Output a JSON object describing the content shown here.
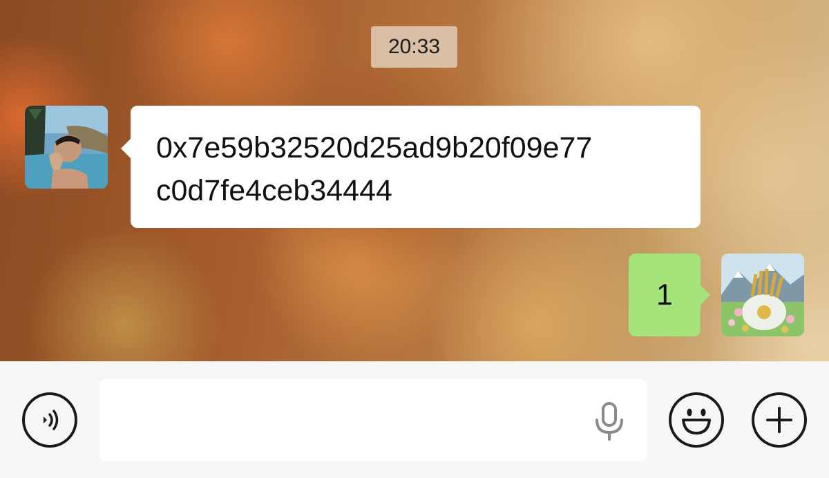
{
  "chat": {
    "time": "20:33",
    "messages": [
      {
        "direction": "incoming",
        "lines": [
          "0x7e59b32520d25ad9b20f09e77",
          "c0d7fe4ceb34444"
        ]
      },
      {
        "direction": "outgoing",
        "text": "1"
      }
    ]
  },
  "input_bar": {
    "input_value": "",
    "icons": {
      "voice": "voice-mode-icon",
      "mic": "microphone-icon",
      "emoji": "emoji-icon",
      "plus": "plus-icon"
    }
  },
  "colors": {
    "incoming_bubble": "#ffffff",
    "outgoing_bubble": "#a4e47a",
    "input_bar_bg": "#f6f6f6",
    "icon_stroke": "#1a1a1a"
  }
}
